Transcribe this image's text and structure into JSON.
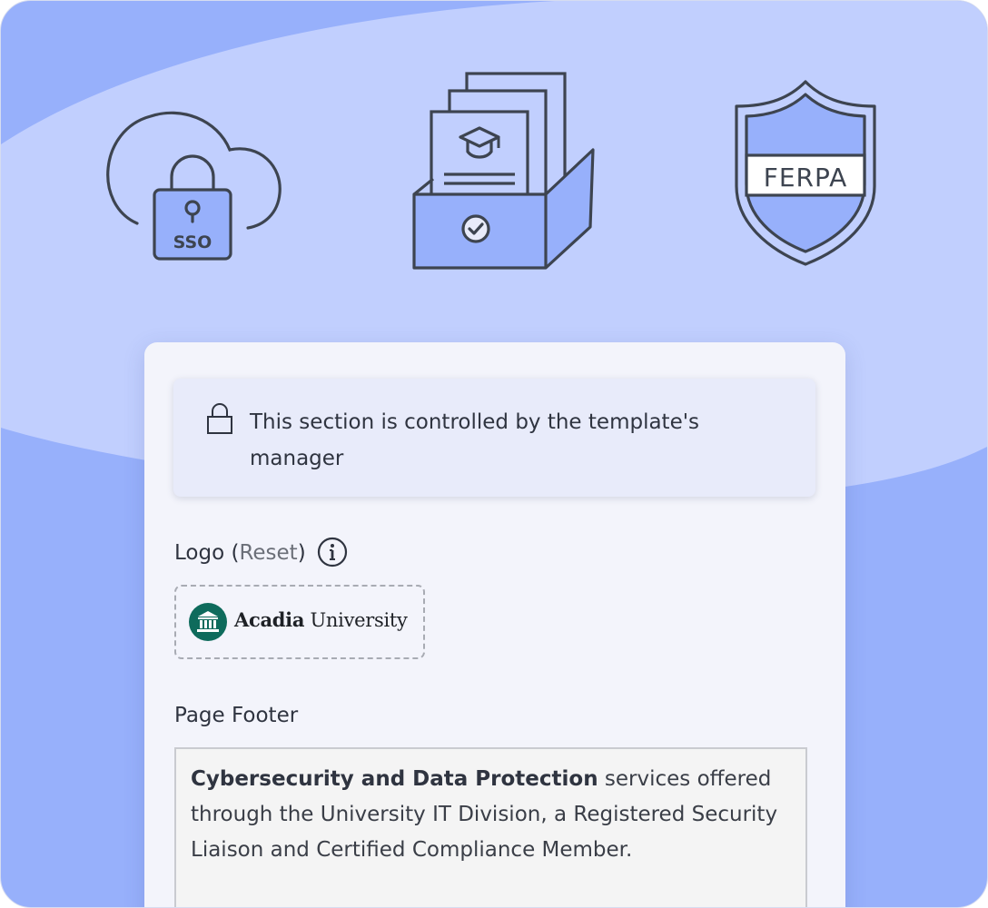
{
  "illustrations": {
    "sso": {
      "icon": "cloud-lock-icon",
      "label": "SSO"
    },
    "archive": {
      "icon": "education-archive-icon"
    },
    "ferpa": {
      "icon": "shield-icon",
      "label": "FERPA"
    }
  },
  "notice": {
    "icon": "lock-icon",
    "text": "This section is controlled by the template's manager"
  },
  "logo": {
    "label": "Logo",
    "paren_open": " (",
    "reset": "Reset",
    "paren_close": ")",
    "info_icon": "info-icon",
    "name_bold": "Acadia",
    "name_rest": " University",
    "badge_icon": "building-columns-icon"
  },
  "footer": {
    "label": "Page Footer",
    "text_bold": "Cybersecurity and Data Protection",
    "text_rest": " services offered through the University IT Division, a Registered Security Liaison and Certified Compliance Member."
  },
  "colors": {
    "background_dark": "#97b0fb",
    "background_light": "#c1cffe",
    "icon_fill": "#97b0fb",
    "icon_stroke": "#3d4450",
    "logo_badge": "#0e6b5c"
  }
}
